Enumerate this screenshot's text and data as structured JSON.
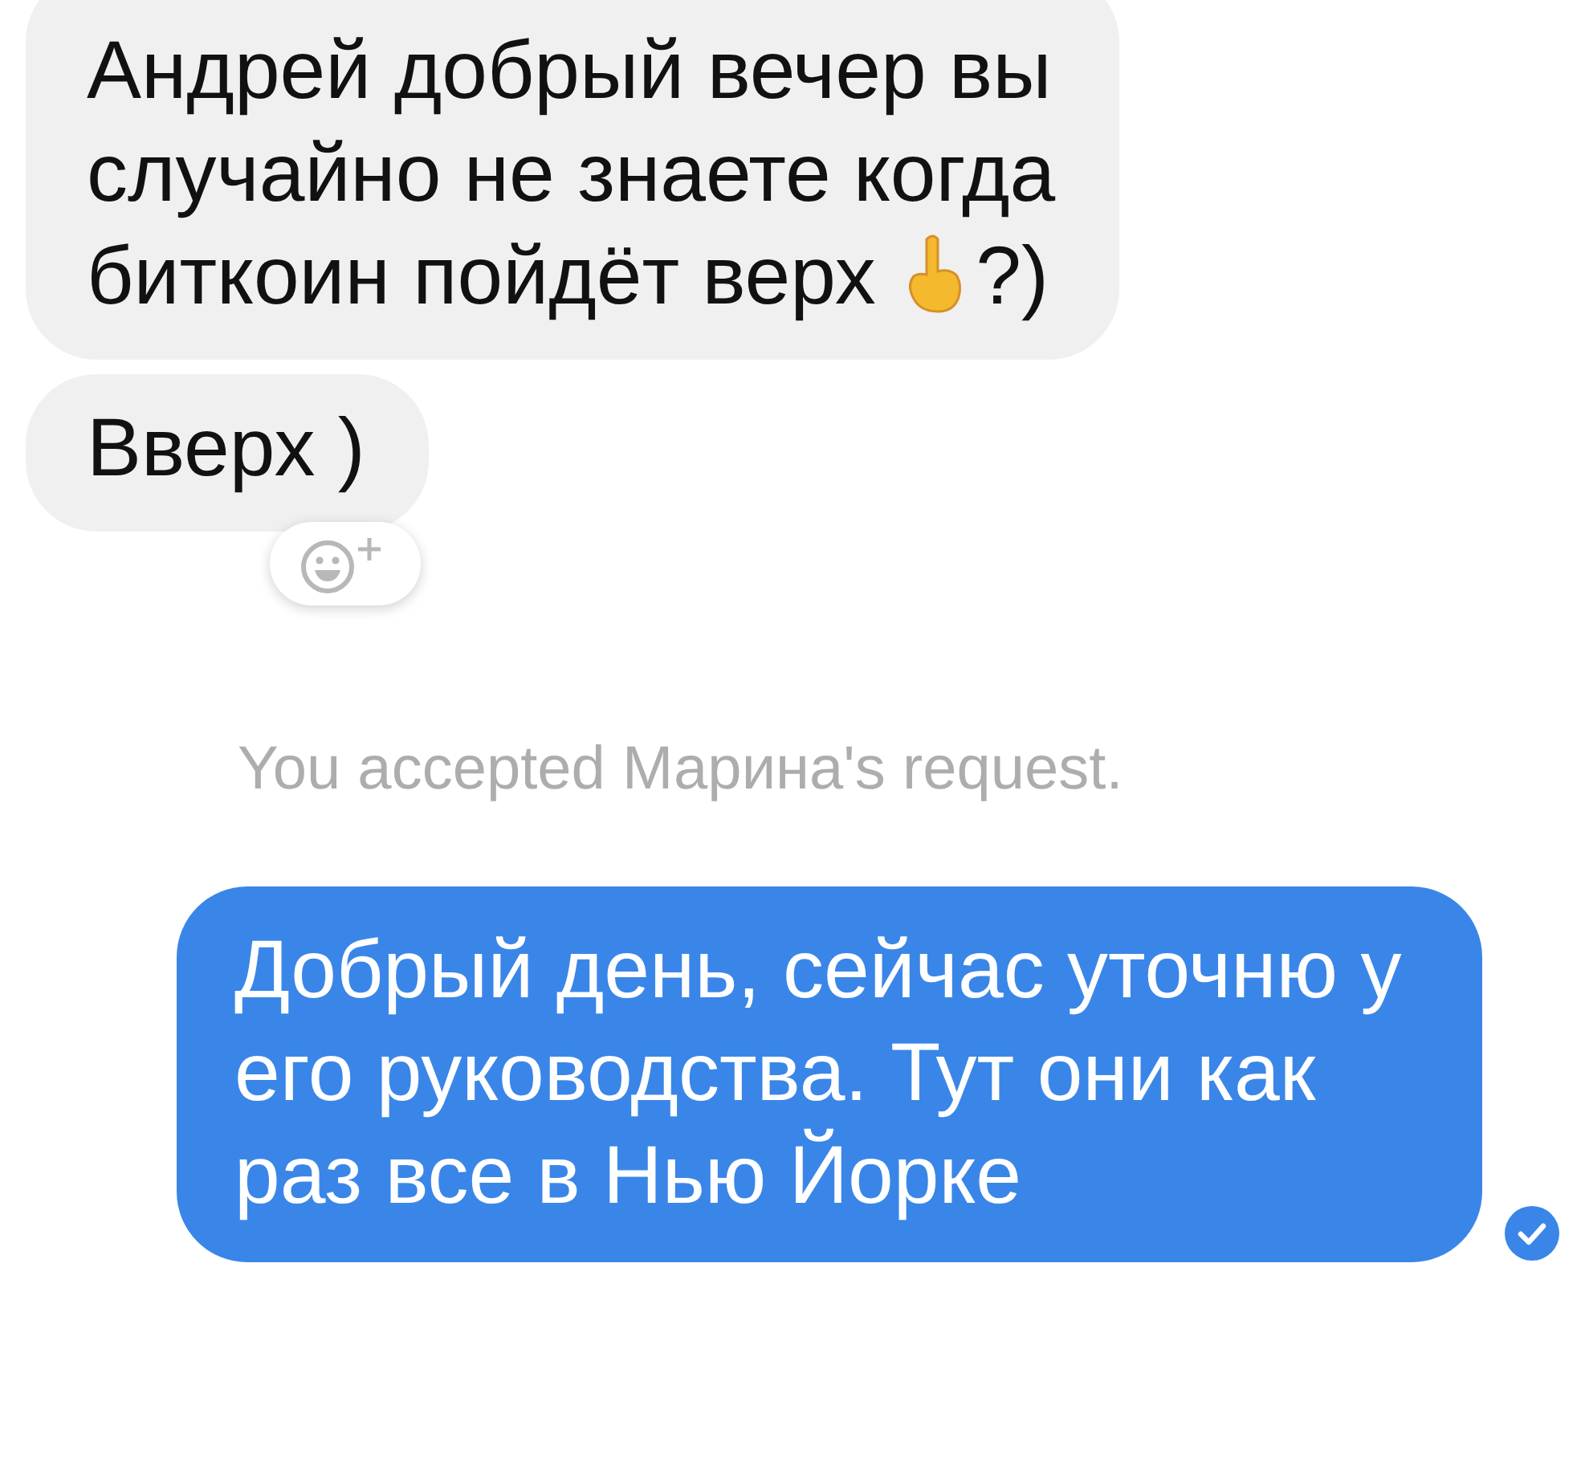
{
  "messages": [
    {
      "kind": "incoming",
      "segments": [
        {
          "kind": "line",
          "text": "Андрей добрый вечер вы"
        },
        {
          "kind": "line",
          "text": "случайно не знаете когда"
        },
        {
          "kind": "text",
          "text": "биткоин пойдёт верх"
        },
        {
          "kind": "emoji"
        },
        {
          "kind": "text",
          "text": "?)"
        }
      ]
    },
    {
      "kind": "incoming",
      "segments": [
        {
          "kind": "text",
          "text": "Вверх )"
        }
      ],
      "reaction_button": true
    },
    {
      "kind": "system",
      "segments": [
        {
          "kind": "text",
          "text": "You accepted Марина's request."
        }
      ]
    },
    {
      "kind": "outgoing",
      "segments": [
        {
          "kind": "text",
          "text": "Добрый день, сейчас уточню у его руководства. Тут они как раз все в Нью Йорке"
        }
      ],
      "delivered": true
    }
  ]
}
